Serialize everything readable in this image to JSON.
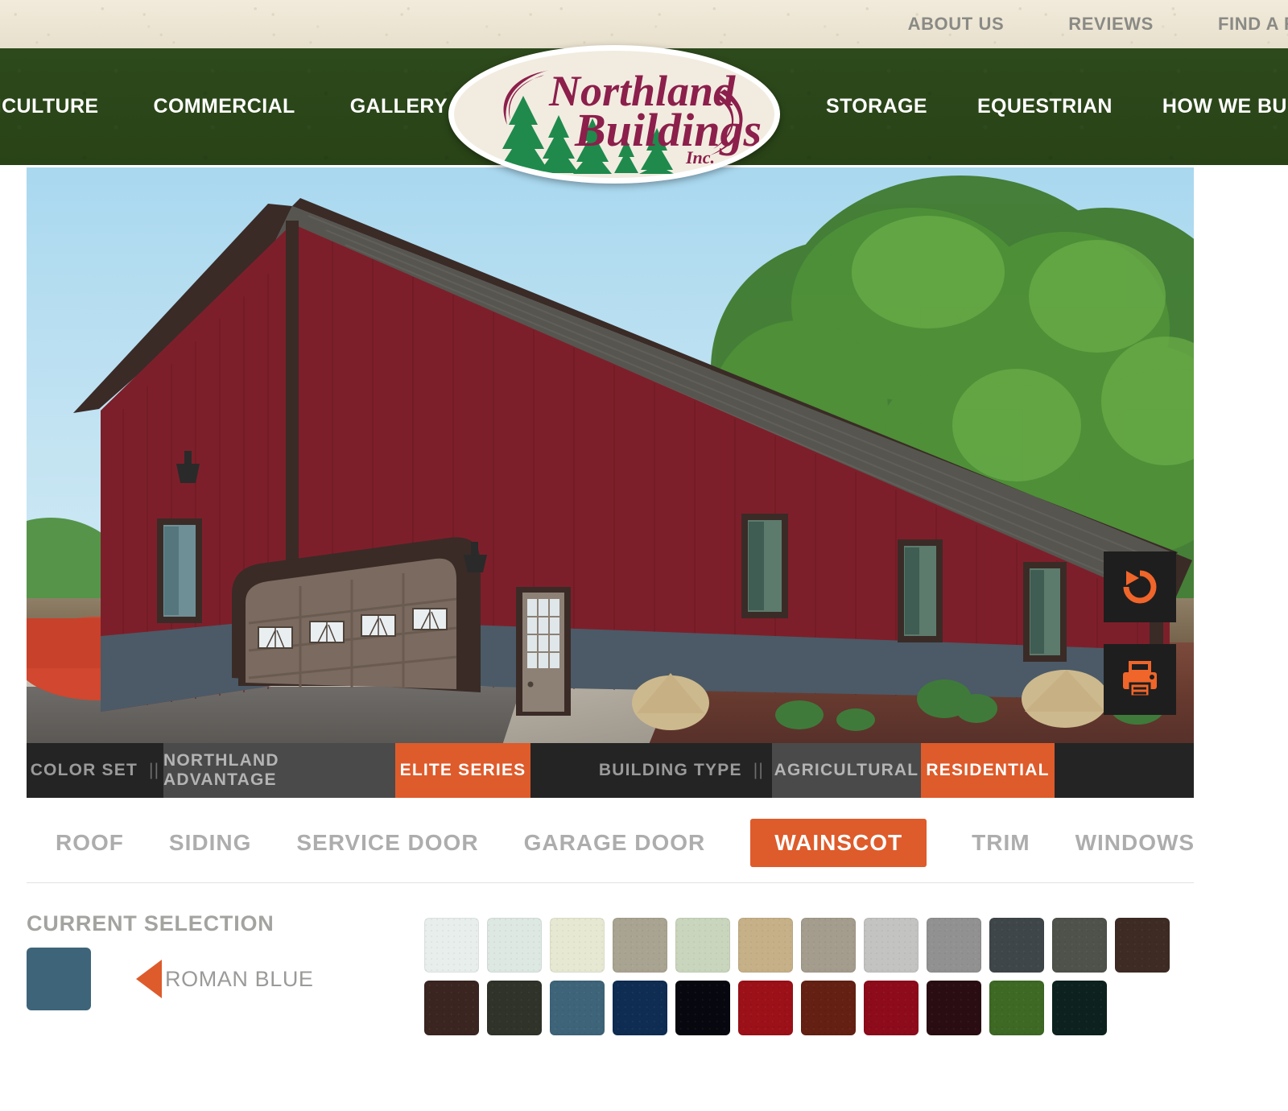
{
  "top_nav": [
    {
      "label": "ABOUT US"
    },
    {
      "label": "REVIEWS"
    },
    {
      "label": "FIND A REP"
    }
  ],
  "main_nav_left": [
    {
      "label": "AGRICULTURE"
    },
    {
      "label": "COMMERCIAL"
    },
    {
      "label": "GALLERY"
    }
  ],
  "main_nav_right": [
    {
      "label": "STORAGE"
    },
    {
      "label": "EQUESTRIAN"
    },
    {
      "label": "HOW WE BUILD"
    }
  ],
  "logo": {
    "line1": "Northland",
    "line2": "Buildings",
    "line3": "Inc.",
    "text_color": "#8c1f4b",
    "tree_color": "#1f8a4c",
    "oval_color": "#f2ece0"
  },
  "stage": {
    "reset_icon": "rotate-ccw-icon",
    "print_icon": "printer-icon",
    "icon_color": "#f0652a",
    "button_bg": "#1e1e1e"
  },
  "building": {
    "roof_color": "#4a4844",
    "siding_color": "#7d1f2a",
    "trim_color": "#3a2b27",
    "wainscot_color": "#4b5a66",
    "garage_door_color": "#7a6a5f",
    "service_door_color": "#8d8075"
  },
  "option_bar": {
    "color_set_label": "COLOR SET",
    "color_set_pipes": "||",
    "color_set_options": [
      {
        "label": "NORTHLAND ADVANTAGE",
        "active": false
      },
      {
        "label": "ELITE SERIES",
        "active": true
      }
    ],
    "building_type_label": "BUILDING TYPE",
    "building_type_pipes": "||",
    "building_type_options": [
      {
        "label": "AGRICULTURAL",
        "active": false
      },
      {
        "label": "RESIDENTIAL",
        "active": true
      }
    ]
  },
  "component_tabs": [
    {
      "label": "ROOF",
      "active": false
    },
    {
      "label": "SIDING",
      "active": false
    },
    {
      "label": "SERVICE DOOR",
      "active": false
    },
    {
      "label": "GARAGE DOOR",
      "active": false
    },
    {
      "label": "WAINSCOT",
      "active": true
    },
    {
      "label": "TRIM",
      "active": false
    },
    {
      "label": "WINDOWS",
      "active": false
    }
  ],
  "current_selection": {
    "title": "CURRENT SELECTION",
    "color_name": "ROMAN BLUE",
    "color_hex": "#3e6479",
    "arrow_color": "#de5b2b"
  },
  "swatch_rows": [
    [
      {
        "hex": "#e8eeec"
      },
      {
        "hex": "#dde8e2"
      },
      {
        "hex": "#e7e8d2"
      },
      {
        "hex": "#a9a391"
      },
      {
        "hex": "#c9d6bd"
      },
      {
        "hex": "#c6b088"
      },
      {
        "hex": "#a49c8c"
      },
      {
        "hex": "#c3c3c1"
      },
      {
        "hex": "#909190"
      },
      {
        "hex": "#3f464a"
      },
      {
        "hex": "#4e524b"
      },
      {
        "hex": "#3e2b23"
      }
    ],
    [
      {
        "hex": "#3b2520"
      },
      {
        "hex": "#2f3329"
      },
      {
        "hex": "#3e6479"
      },
      {
        "hex": "#0f2c52"
      },
      {
        "hex": "#07070f"
      },
      {
        "hex": "#9c1018"
      },
      {
        "hex": "#642012"
      },
      {
        "hex": "#8d0b1b"
      },
      {
        "hex": "#2a0d12"
      },
      {
        "hex": "#3d6924"
      },
      {
        "hex": "#0d221e"
      }
    ]
  ],
  "accent": {
    "orange": "#de5b2b",
    "green": "#2a4419",
    "dark": "#242424"
  }
}
